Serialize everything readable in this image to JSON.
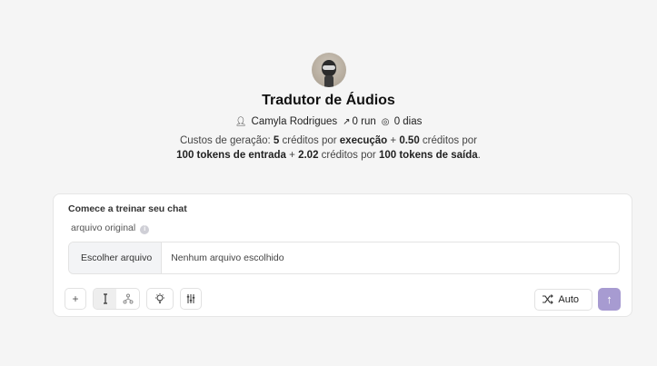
{
  "app": {
    "title": "Tradutor de Áudios",
    "author": "Camyla Rodrigues",
    "runs": "0 run",
    "days": "0 dias",
    "icons": {
      "author": "user-icon",
      "runs": "rocket-icon",
      "days": "coin-icon"
    }
  },
  "cost": {
    "p1": "Custos de geração: ",
    "b1": "5",
    "p2": " créditos por ",
    "b2": "execução",
    "p3": " + ",
    "b3": "0.50",
    "p4": " créditos por",
    "b4": "100 tokens de entrada",
    "p5": " + ",
    "b5": "2.02",
    "p6": " créditos por ",
    "b6": "100 tokens de saída",
    "p7": "."
  },
  "card": {
    "title": "Comece a treinar seu chat",
    "field_label": "arquivo original",
    "info": "i",
    "file_button": "Escolher arquivo",
    "file_status": "Nenhum arquivo escolhido"
  },
  "toolbar": {
    "add": "+",
    "auto_label": "Auto",
    "send": "↑"
  },
  "colors": {
    "send": "#a79bd1",
    "background": "#f5f5f5"
  }
}
